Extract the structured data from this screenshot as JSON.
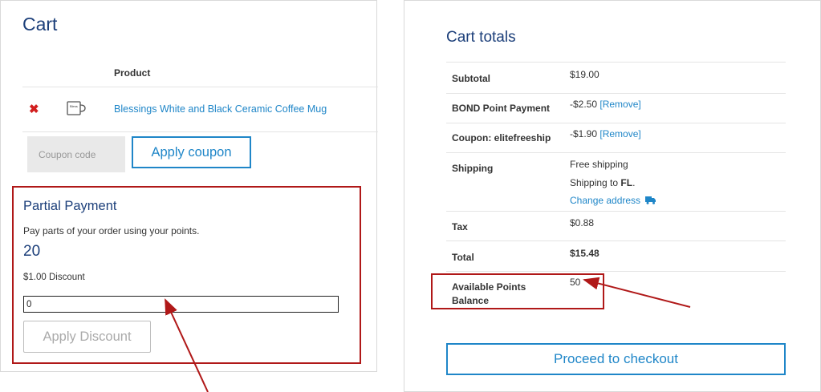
{
  "cart": {
    "title": "Cart",
    "column_product": "Product",
    "item": {
      "remove_glyph": "✖",
      "name": "Blessings White and Black Ceramic Coffee Mug",
      "mug_text": "Bless"
    },
    "coupon_placeholder": "Coupon code",
    "apply_coupon_label": "Apply coupon"
  },
  "partial_payment": {
    "title": "Partial Payment",
    "description": "Pay parts of your order using your points.",
    "points": "20",
    "discount_text": "$1.00 Discount",
    "input_value": "0",
    "apply_label": "Apply Discount"
  },
  "totals": {
    "title": "Cart totals",
    "subtotal_label": "Subtotal",
    "subtotal_value": "$19.00",
    "bond_label": "BOND Point Payment",
    "bond_value": "-$2.50",
    "coupon_label": "Coupon: elitefreeship",
    "coupon_value": "-$1.90",
    "remove_link": "[Remove]",
    "shipping_label": "Shipping",
    "shipping_method": "Free shipping",
    "shipping_to_prefix": "Shipping to ",
    "shipping_to_state": "FL",
    "shipping_to_suffix": ".",
    "change_address": "Change address",
    "tax_label": "Tax",
    "tax_value": "$0.88",
    "total_label": "Total",
    "total_value": "$15.48",
    "available_label_line1": "Available Points",
    "available_label_line2": "Balance",
    "available_value": "50",
    "checkout_label": "Proceed to checkout"
  },
  "colors": {
    "heading": "#1c3f7a",
    "link": "#1f86c8",
    "highlight_red": "#b01818",
    "remove_red": "#d21f1f"
  }
}
